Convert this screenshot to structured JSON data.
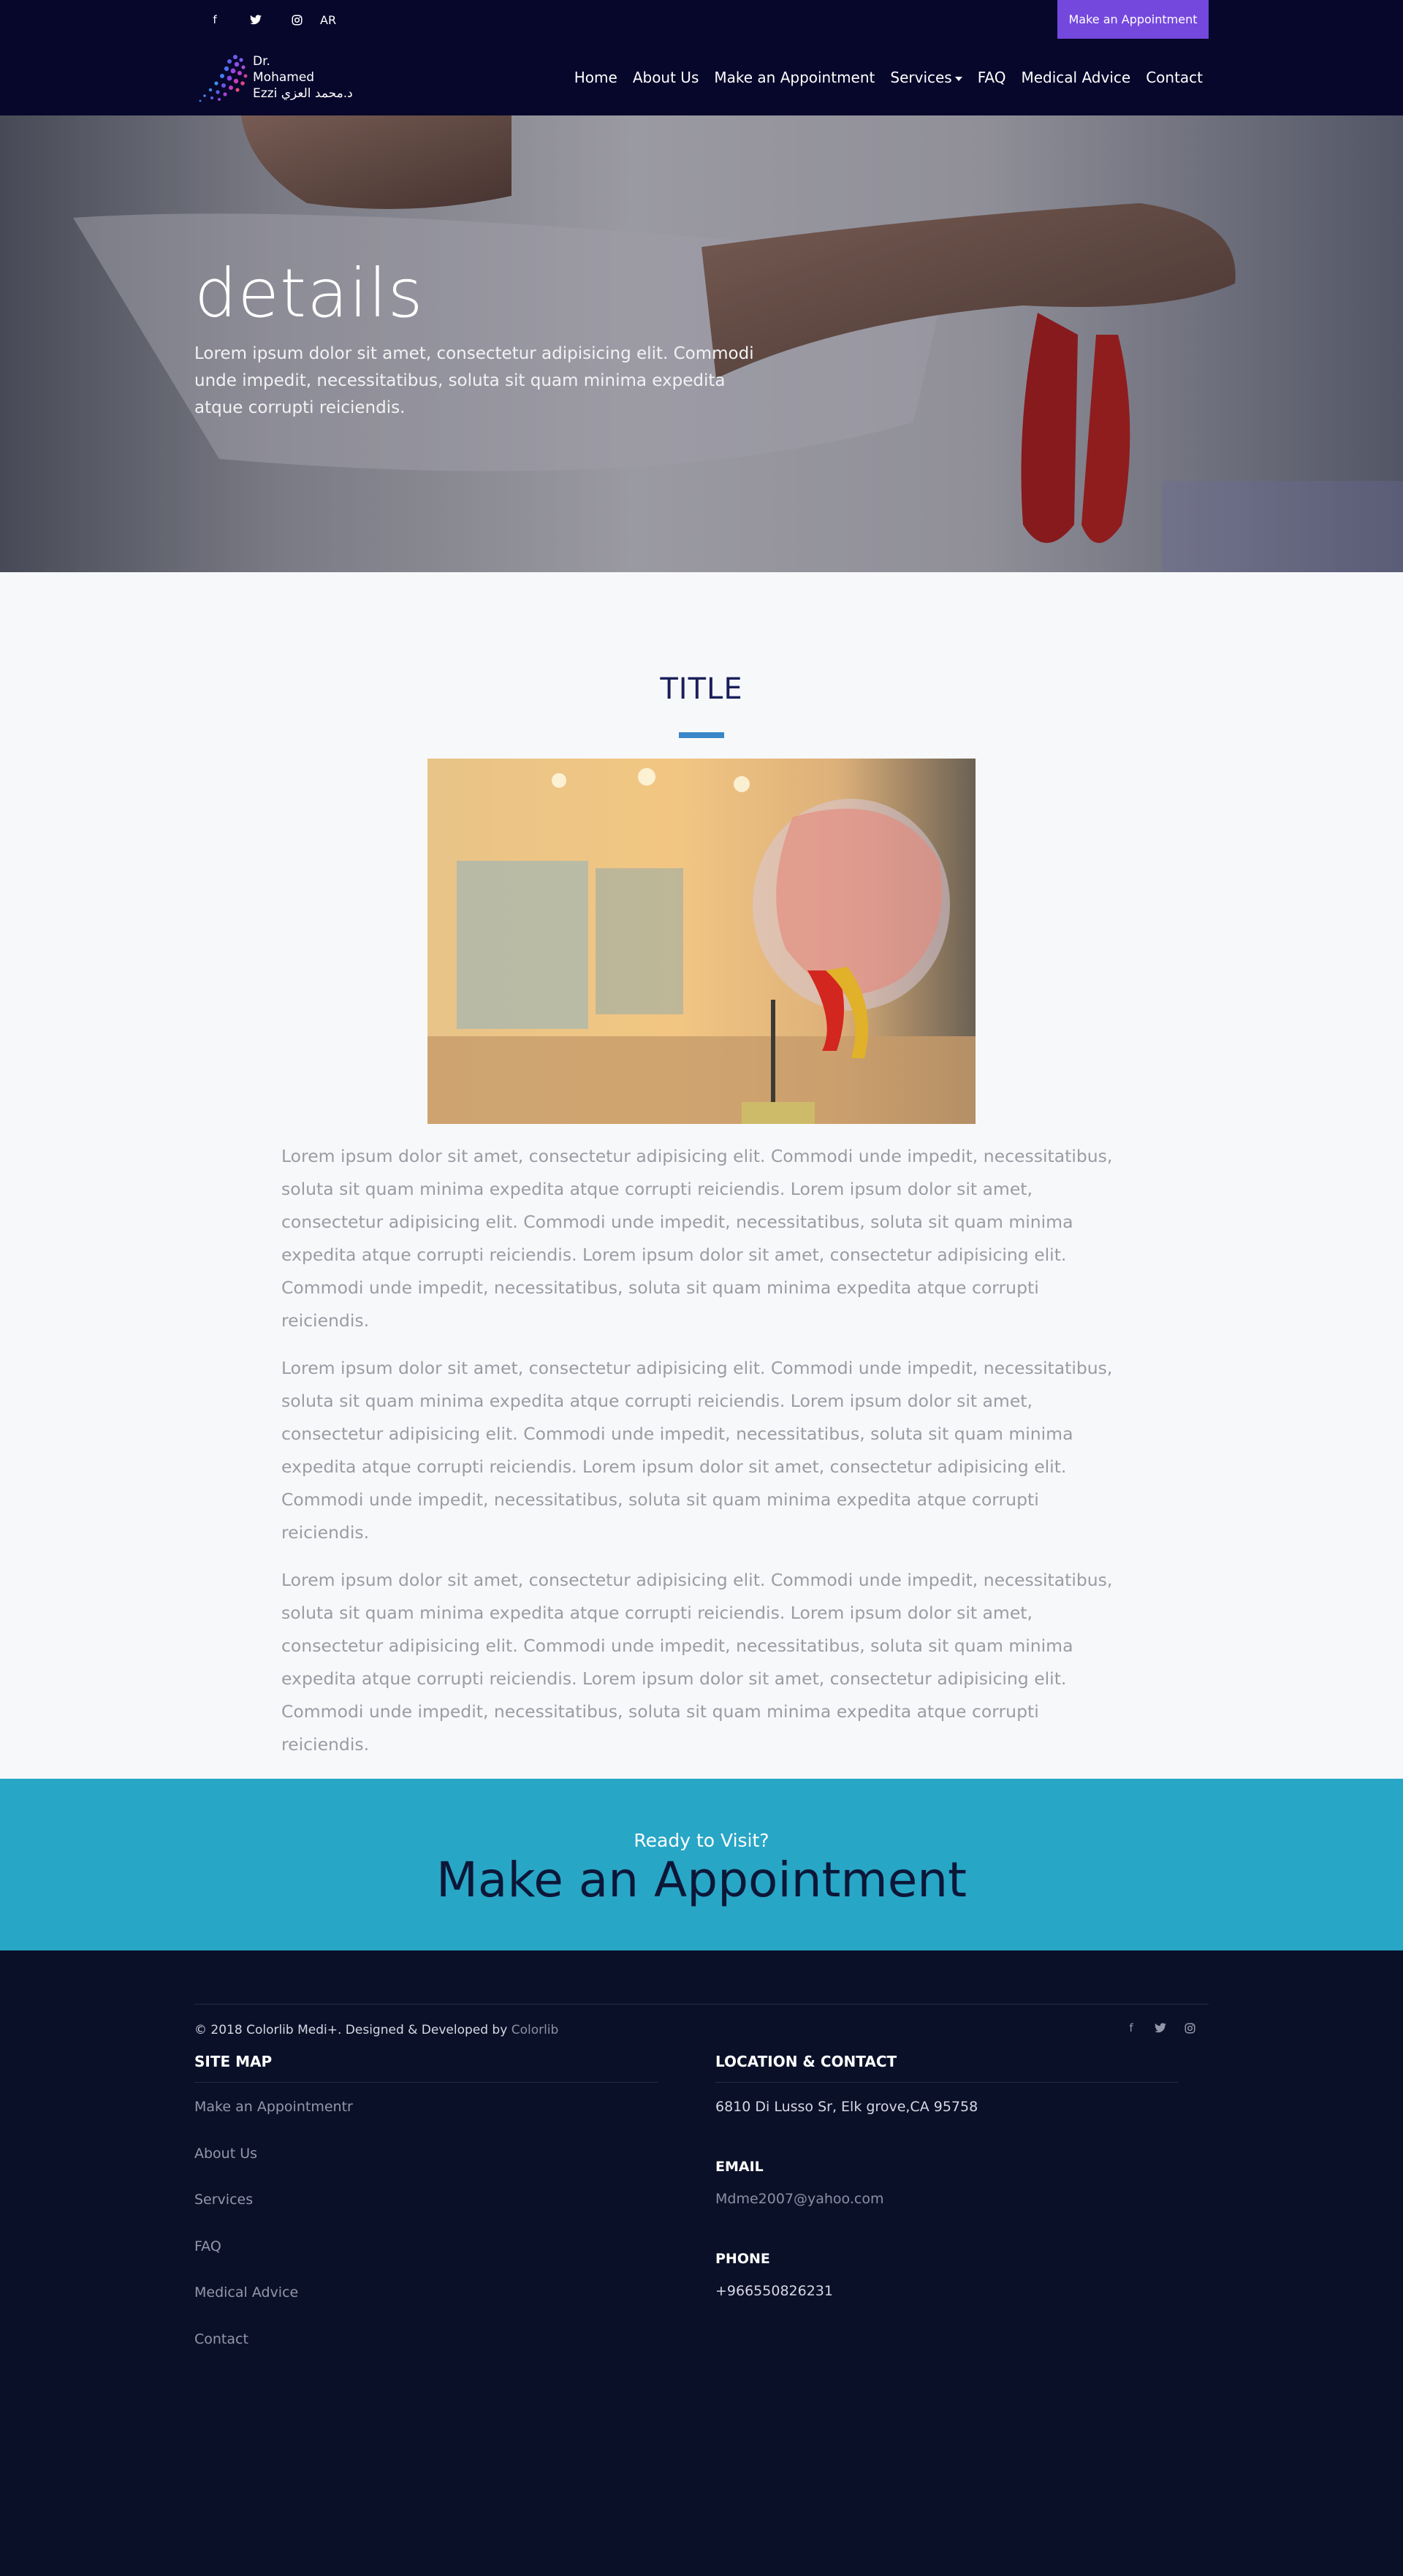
{
  "topbar": {
    "social": [
      {
        "icon": "facebook-icon",
        "glyph": "f"
      },
      {
        "icon": "twitter-icon",
        "glyph": "t"
      },
      {
        "icon": "instagram-icon",
        "glyph": "◎"
      }
    ],
    "lang": "AR",
    "appointment_label": "Make an Appointment"
  },
  "logo": {
    "line1": "Dr.",
    "line2": "Mohamed",
    "line3": "Ezzi د.محمد العزي"
  },
  "nav": {
    "items": [
      "Home",
      "About Us",
      "Make an Appointment",
      "Services",
      "FAQ",
      "Medical Advice",
      "Contact"
    ]
  },
  "hero": {
    "title": "details",
    "subtitle": "Lorem ipsum dolor sit amet, consectetur adipisicing elit. Commodi unde impedit, necessitatibus, soluta sit quam minima expedita atque corrupti reiciendis."
  },
  "content": {
    "title": "TITLE",
    "paragraphs": [
      "Lorem ipsum dolor sit amet, consectetur adipisicing elit. Commodi unde impedit, necessitatibus, soluta sit quam minima expedita atque corrupti reiciendis. Lorem ipsum dolor sit amet, consectetur adipisicing elit. Commodi unde impedit, necessitatibus, soluta sit quam minima expedita atque corrupti reiciendis. Lorem ipsum dolor sit amet, consectetur adipisicing elit. Commodi unde impedit, necessitatibus, soluta sit quam minima expedita atque corrupti reiciendis.",
      "Lorem ipsum dolor sit amet, consectetur adipisicing elit. Commodi unde impedit, necessitatibus, soluta sit quam minima expedita atque corrupti reiciendis. Lorem ipsum dolor sit amet, consectetur adipisicing elit. Commodi unde impedit, necessitatibus, soluta sit quam minima expedita atque corrupti reiciendis. Lorem ipsum dolor sit amet, consectetur adipisicing elit. Commodi unde impedit, necessitatibus, soluta sit quam minima expedita atque corrupti reiciendis.",
      "Lorem ipsum dolor sit amet, consectetur adipisicing elit. Commodi unde impedit, necessitatibus, soluta sit quam minima expedita atque corrupti reiciendis. Lorem ipsum dolor sit amet, consectetur adipisicing elit. Commodi unde impedit, necessitatibus, soluta sit quam minima expedita atque corrupti reiciendis. Lorem ipsum dolor sit amet, consectetur adipisicing elit. Commodi unde impedit, necessitatibus, soluta sit quam minima expedita atque corrupti reiciendis."
    ]
  },
  "cta": {
    "subtitle": "Ready to Visit?",
    "title": "Make an Appointment"
  },
  "footer": {
    "sitemap_title": "SITE MAP",
    "sitemap_links": [
      "Make an Appointmentr",
      "About Us",
      "Services",
      "FAQ",
      "Medical Advice",
      "Contact"
    ],
    "location_title": "LOCATION & CONTACT",
    "address": "6810 Di Lusso Sr, Elk grove,CA 95758",
    "email_title": "EMAIL",
    "email": "Mdme2007@yahoo.com",
    "phone_title": "PHONE",
    "phone": "+966550826231",
    "copyright": "© 2018 Colorlib Medi+. Designed & Developed by ",
    "credit": "Colorlib",
    "social": [
      {
        "icon": "facebook-icon",
        "glyph": "f"
      },
      {
        "icon": "twitter-icon",
        "glyph": "t"
      },
      {
        "icon": "instagram-icon",
        "glyph": "◎"
      }
    ]
  },
  "colors": {
    "navy": "#07062b",
    "accent_purple": "#7448dd",
    "cta_blue": "#28a6c6",
    "footer_bg": "#0b1029",
    "title_bar": "#3a86c8"
  }
}
